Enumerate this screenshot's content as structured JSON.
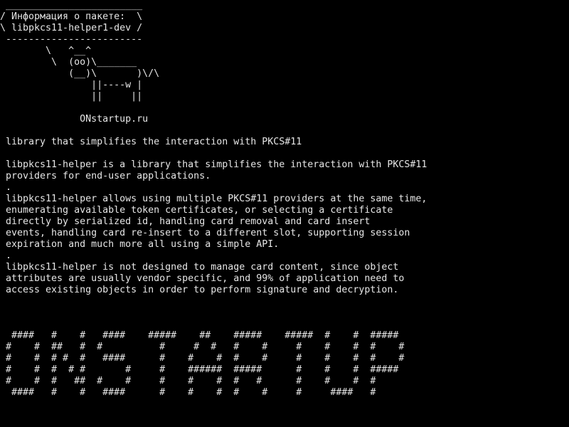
{
  "terminal": {
    "background_color": "#000000",
    "text_color": "#e6e6e6",
    "lines": [
      " ________________________",
      "/ Информация о пакете:  \\",
      "\\ libpkcs11-helper1-dev /",
      " ------------------------",
      "        \\   ^__^",
      "         \\  (oo)\\_______",
      "            (__)\\       )\\/\\",
      "                ||----w |",
      "                ||     ||",
      "",
      "              ONstartup.ru",
      "",
      " library that simplifies the interaction with PKCS#11",
      "",
      " libpkcs11-helper is a library that simplifies the interaction with PKCS#11",
      " providers for end-user applications.",
      " .",
      " libpkcs11-helper allows using multiple PKCS#11 providers at the same time,",
      " enumerating available token certificates, or selecting a certificate",
      " directly by serialized id, handling card removal and card insert",
      " events, handling card re-insert to a different slot, supporting session",
      " expiration and much more all using a simple API.",
      " .",
      " libpkcs11-helper is not designed to manage card content, since object",
      " attributes are usually vendor specific, and 99% of application need to",
      " access existing objects in order to perform signature and decryption.",
      "",
      "",
      "",
      "  ####   #    #   ####    #####    ##    #####    #####  #    #  #####",
      " #    #  ##   #  #          #     #  #   #    #     #    #    #  #    #",
      " #    #  # #  #   ####      #    #    #  #    #     #    #    #  #    #",
      " #    #  #  # #       #     #    ######  #####      #    #    #  #####",
      " #    #  #   ##  #    #     #    #    #  #   #      #    #    #  #",
      "  ####   #    #   ####      #    #    #  #    #     #     ####   #"
    ]
  }
}
